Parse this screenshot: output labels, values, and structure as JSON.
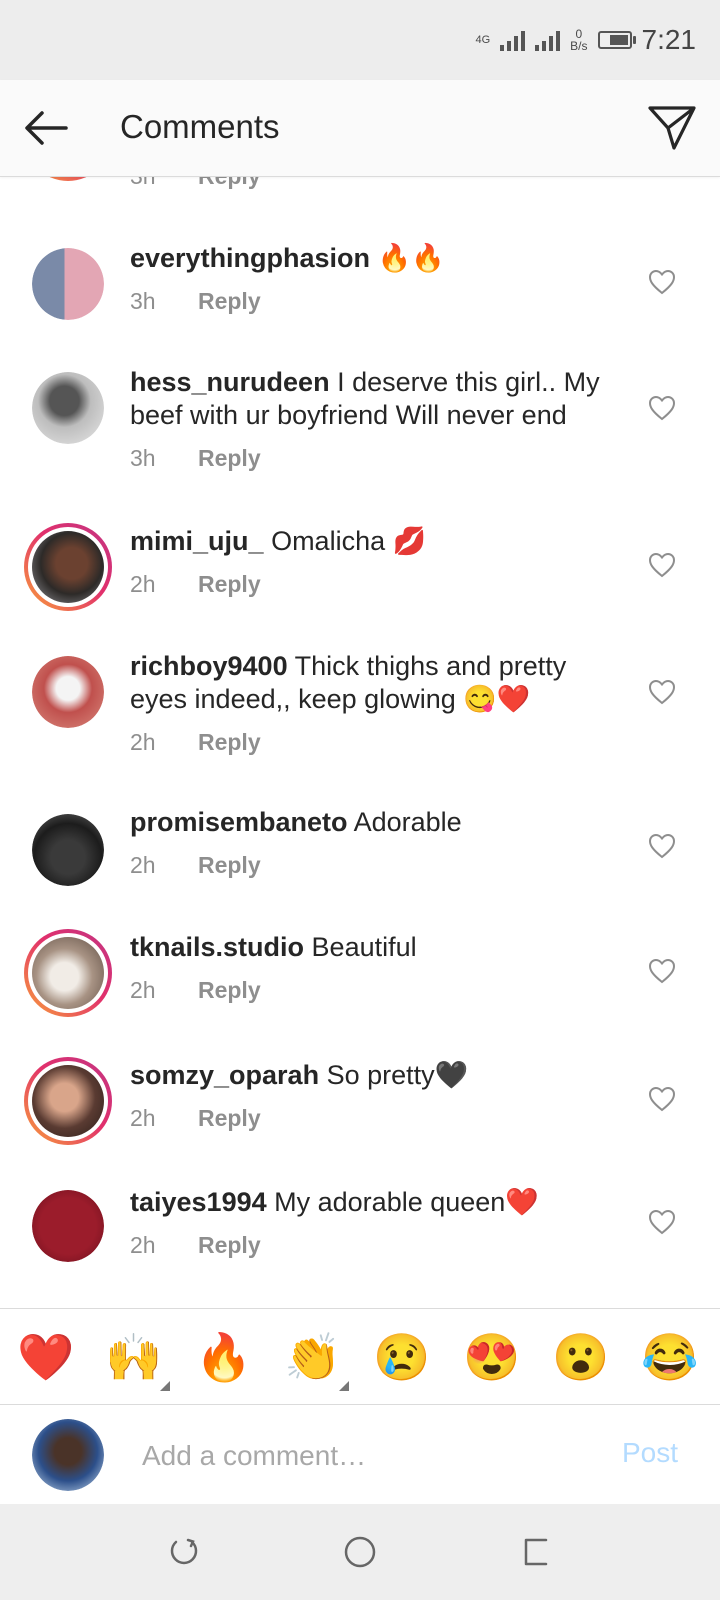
{
  "status_bar": {
    "network": "4G",
    "speed_value": "0",
    "speed_unit": "B/s",
    "time": "7:21"
  },
  "header": {
    "title": "Comments",
    "back_icon": "arrow-left-icon",
    "send_icon": "paper-plane-icon"
  },
  "comments": [
    {
      "username": "",
      "text": "",
      "time": "3h",
      "reply": "Reply",
      "story_ring": true
    },
    {
      "username": "everythingphasion",
      "text": "🔥🔥",
      "time": "3h",
      "reply": "Reply",
      "story_ring": false
    },
    {
      "username": "hess_nurudeen",
      "text": "I deserve this girl.. My beef with ur boyfriend Will never end",
      "time": "3h",
      "reply": "Reply",
      "story_ring": false
    },
    {
      "username": "mimi_uju_",
      "text": "Omalicha 💋",
      "time": "2h",
      "reply": "Reply",
      "story_ring": true
    },
    {
      "username": "richboy9400",
      "text": "Thick thighs and pretty eyes indeed,, keep glowing 😋❤️",
      "time": "2h",
      "reply": "Reply",
      "story_ring": false
    },
    {
      "username": "promisembaneto",
      "text": "Adorable",
      "time": "2h",
      "reply": "Reply",
      "story_ring": false
    },
    {
      "username": "tknails.studio",
      "text": "Beautiful",
      "time": "2h",
      "reply": "Reply",
      "story_ring": true
    },
    {
      "username": "somzy_oparah",
      "text": "So pretty🖤",
      "time": "2h",
      "reply": "Reply",
      "story_ring": true
    },
    {
      "username": "taiyes1994",
      "text": "My adorable queen❤️",
      "time": "2h",
      "reply": "Reply",
      "story_ring": false
    }
  ],
  "emoji_bar": [
    "❤️",
    "🙌",
    "🔥",
    "👏",
    "😢",
    "😍",
    "😮",
    "😂"
  ],
  "composer": {
    "placeholder": "Add a comment…",
    "post_label": "Post"
  },
  "colors": {
    "post_disabled": "#b3dbff",
    "meta_gray": "#8e8e8e",
    "story_ring_start": "#f9a13a",
    "story_ring_end": "#c13584"
  }
}
